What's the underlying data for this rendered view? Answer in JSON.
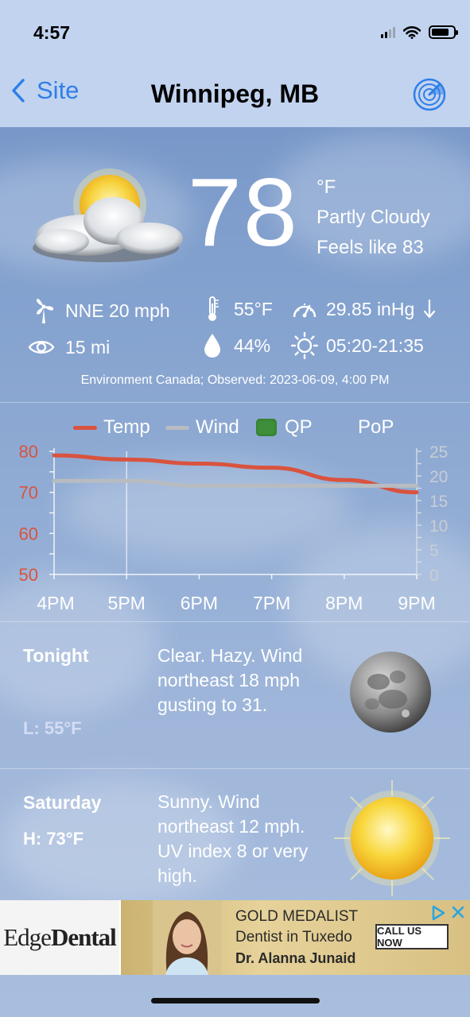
{
  "status": {
    "time": "4:57"
  },
  "nav": {
    "back_label": "Site",
    "title": "Winnipeg, MB"
  },
  "current": {
    "temp": "78",
    "unit": "°F",
    "condition": "Partly Cloudy",
    "feels_like": "Feels like 83",
    "wind": "NNE 20 mph",
    "dewpoint": "55°F",
    "pressure": "29.85 inHg",
    "pressure_trend_icon": "arrow-down-icon",
    "visibility": "15 mi",
    "humidity": "44%",
    "sun": "05:20-21:35",
    "observed": "Environment Canada; Observed: 2023-06-09, 4:00 PM"
  },
  "legend": {
    "temp": "Temp",
    "wind": "Wind",
    "qp": "QP",
    "pop": "PoP"
  },
  "colors": {
    "temp": "#d9533e",
    "wind": "#b8bcc0",
    "qp": "#3f8f3a",
    "accent": "#2f7fe8"
  },
  "chart_data": {
    "type": "line",
    "x": [
      "4PM",
      "5PM",
      "6PM",
      "7PM",
      "8PM",
      "9PM"
    ],
    "series": [
      {
        "name": "Temp",
        "axis": "left",
        "values": [
          79,
          78,
          77,
          76,
          73,
          70
        ]
      },
      {
        "name": "Wind",
        "axis": "right",
        "values": [
          19,
          19,
          18,
          18,
          18,
          18
        ]
      }
    ],
    "left_ticks": [
      "80",
      "70",
      "60",
      "50"
    ],
    "right_ticks": [
      "25",
      "20",
      "15",
      "10",
      "5",
      "0"
    ],
    "ylim_left": [
      50,
      80
    ],
    "ylim_right": [
      0,
      25
    ],
    "marker_x": "5PM"
  },
  "forecast": [
    {
      "name": "Tonight",
      "temp": "L: 55°F",
      "text": "Clear. Hazy. Wind northeast 18 mph gusting to 31.",
      "icon": "moon-icon"
    },
    {
      "name": "Saturday",
      "temp": "H: 73°F",
      "text": "Sunny. Wind northeast 12 mph. UV index 8 or very high.",
      "icon": "sun-icon"
    }
  ],
  "ad": {
    "logo_a": "Edge",
    "logo_b": "Dental",
    "line1": "GOLD MEDALIST",
    "line2": "Dentist in Tuxedo",
    "line3": "Dr. Alanna Junaid",
    "cta": "CALL US NOW"
  }
}
